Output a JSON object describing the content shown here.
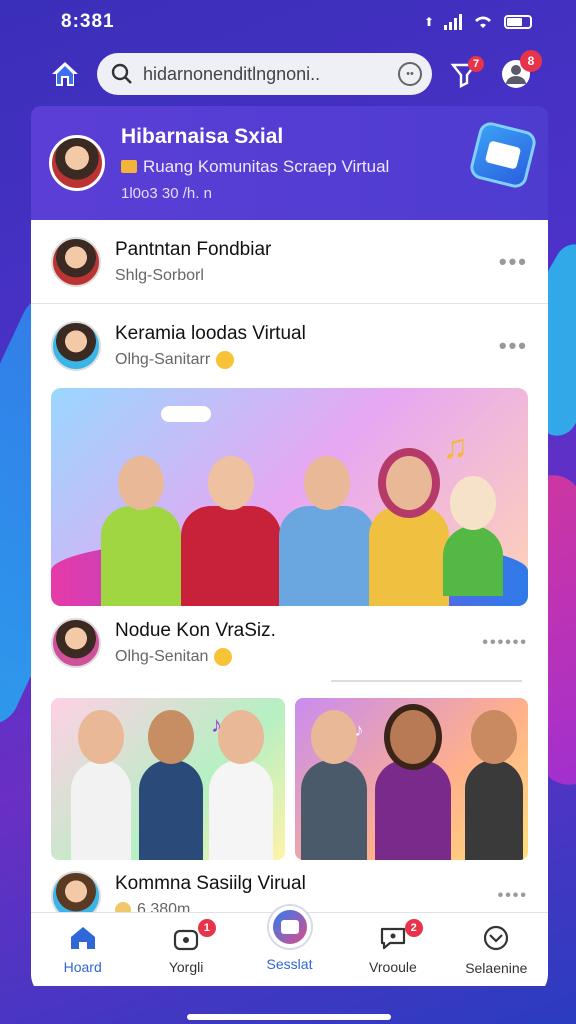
{
  "status_bar": {
    "time": "8:381"
  },
  "search": {
    "text": "hidarnonenditlngnoni.."
  },
  "notifications": {
    "filter_badge": "7",
    "profile_badge": "8"
  },
  "header": {
    "title": "Hibarnaisa Sxial",
    "subtitle": "Ruang Komunitas Scraep Virtual",
    "meta": "1l0o3 30 /h. n"
  },
  "posts": [
    {
      "title": "Pantntan Fondbiar",
      "sub": "Shlg-Sorborl"
    },
    {
      "title": "Keramia loodas Virtual",
      "sub": "Olhg-Sanitarr"
    },
    {
      "title": "Nodue Kon VraSiz.",
      "sub": "Olhg-Senitan"
    },
    {
      "title": "Kommna Sasiilg Virual",
      "sub": "6.380m"
    }
  ],
  "bottom_nav": [
    {
      "label": "Hoard",
      "icon": "home-icon",
      "badge": ""
    },
    {
      "label": "Yorgli",
      "icon": "bag-icon",
      "badge": "1"
    },
    {
      "label": "Sesslat",
      "icon": "create-icon",
      "badge": ""
    },
    {
      "label": "Vrooule",
      "icon": "chat-icon",
      "badge": "2"
    },
    {
      "label": "Selaenine",
      "icon": "settings-icon",
      "badge": ""
    }
  ],
  "colors": {
    "accent": "#2f66d8",
    "header_bg": "#5b3ed6",
    "badge": "#e8344a"
  }
}
